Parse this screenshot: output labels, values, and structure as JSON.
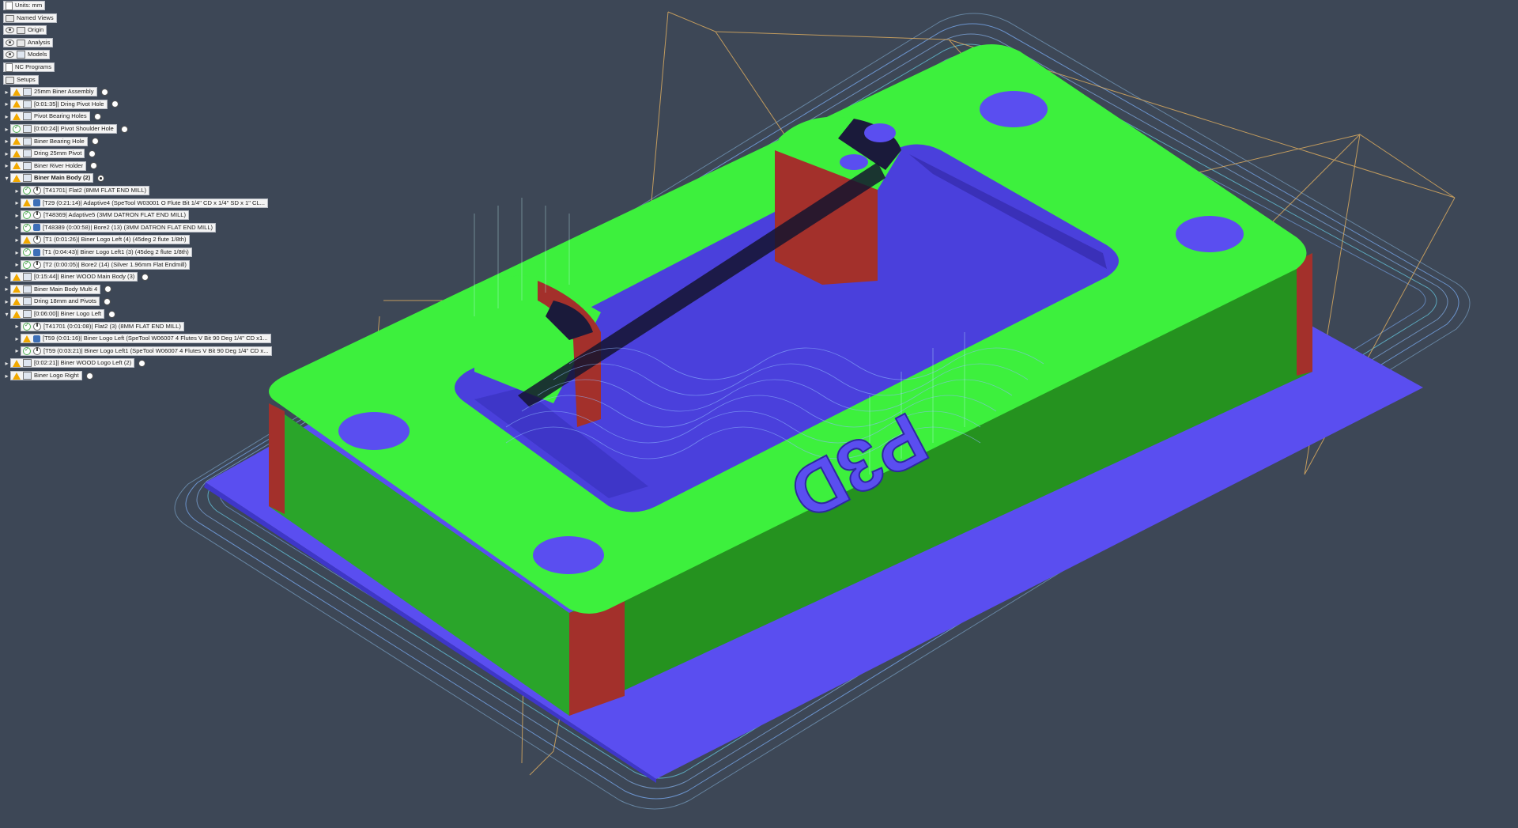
{
  "browser": {
    "top": [
      {
        "label": "Units: mm",
        "icon": "document-icon"
      },
      {
        "label": "Named Views",
        "icon": "folder-icon"
      },
      {
        "label": "Origin",
        "icon": "folder-icon"
      },
      {
        "label": "Analysis",
        "icon": "folder-icon"
      },
      {
        "label": "Models",
        "icon": "component-icon"
      },
      {
        "label": "NC Programs",
        "icon": "nc-program-icon"
      },
      {
        "label": "Setups",
        "icon": "folder-icon"
      }
    ],
    "setups": [
      {
        "label": "25mm Biner Assembly",
        "status": "warning"
      },
      {
        "label": "[0:01:35]| Dring Pivot Hole",
        "status": "warning"
      },
      {
        "label": "Pivot Bearing Holes",
        "status": "warning"
      },
      {
        "label": "[0:00:24]| Pivot Shoulder Hole",
        "status": "ok"
      },
      {
        "label": "Biner Bearing Hole",
        "status": "warning"
      },
      {
        "label": "Dring 25mm Pivot",
        "status": "warning"
      },
      {
        "label": "Biner River Holder",
        "status": "warning"
      },
      {
        "label": "Biner Main Body (2)",
        "status": "warning",
        "active": true,
        "ops": [
          "[T41701| Flat2 (8MM FLAT END MILL)",
          "[T29 (0:21:14)| Adaptive4 (SpeTool W03001 O Flute Bit 1/4\" CD x 1/4\" SD x 1\" CL...",
          "[T48369| Adaptive5 (3MM DATRON FLAT END MILL)",
          "[T48389 (0:00:58)| Bore2 (13) (3MM DATRON FLAT END MILL)",
          "[T1 (0:01:26)| Biner Logo Left (4) (45deg 2 flute 1/8th)",
          "[T1 (0:04:43)| Biner Logo Left1 (3) (45deg 2 flute 1/8th)",
          "[T2 (0:00:05)| Bore2 (14) (Silver 1.96mm Flat Endmill)"
        ]
      },
      {
        "label": "[0:15:44]| Biner WOOD Main Body (3)",
        "status": "warning"
      },
      {
        "label": "Biner Main Body Multi 4",
        "status": "warning"
      },
      {
        "label": "Dring 18mm and Pivots",
        "status": "warning"
      },
      {
        "label": "[0:06:00]| Biner Logo Left",
        "status": "warning",
        "ops": [
          "[T41701 (0:01:08)| Flat2 (3) (8MM FLAT END MILL)",
          "[T59 (0:01:16)| Biner Logo Left (SpeTool W06007 4 Flutes V Bit 90 Deg 1/4\" CD x1...",
          "[T59 (0:03:21)| Biner Logo Left1 (SpeTool W06007 4 Flutes V Bit 90 Deg 1/4\" CD x..."
        ]
      },
      {
        "label": "[0:02:21]| Biner WOOD  Logo Left (2)",
        "status": "warning"
      },
      {
        "label": "Biner Logo Right",
        "status": "warning"
      }
    ]
  },
  "model": {
    "engraving": "P3D",
    "colors": {
      "background": "#3d4756",
      "top_face": "#3df03d",
      "side_face": "#29a12a",
      "stock": "#5a4ef0",
      "pocket": "#3e36c8",
      "red_wall": "#a3302b",
      "toolpath_blue": "#7fb3ff",
      "toolpath_cyan": "#6fe6ff",
      "rapid": "#e3b060"
    }
  }
}
